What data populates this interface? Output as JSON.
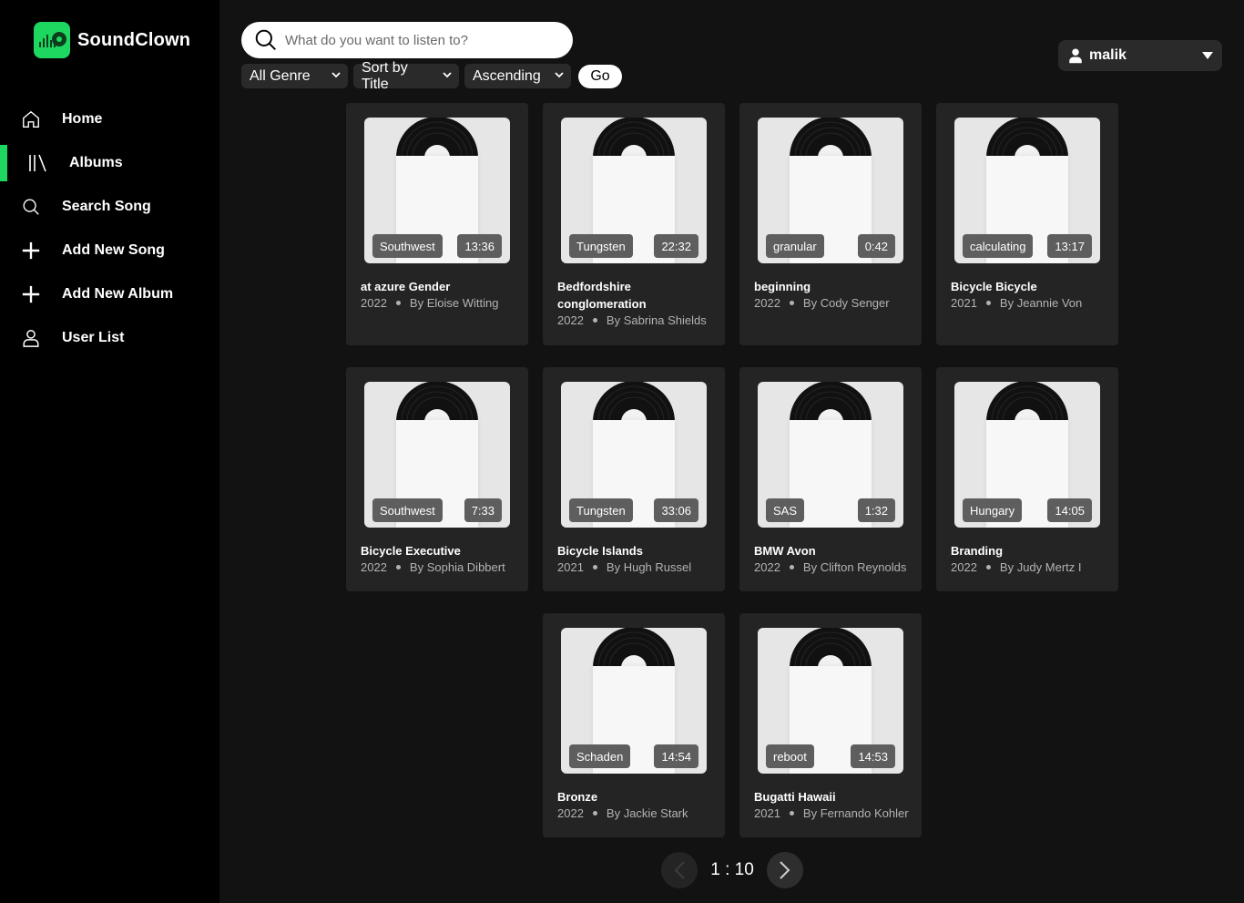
{
  "app": {
    "name": "SoundClown",
    "accent": "#1ed760"
  },
  "sidebar": {
    "items": [
      {
        "label": "Home",
        "icon": "home-icon",
        "active": false
      },
      {
        "label": "Albums",
        "icon": "library-icon",
        "active": true
      },
      {
        "label": "Search Song",
        "icon": "search-icon",
        "active": false
      },
      {
        "label": "Add New Song",
        "icon": "plus-icon",
        "active": false
      },
      {
        "label": "Add New Album",
        "icon": "plus-icon",
        "active": false
      },
      {
        "label": "User List",
        "icon": "user-icon",
        "active": false
      }
    ]
  },
  "search": {
    "placeholder": "What do you want to listen to?",
    "value": ""
  },
  "filters": {
    "genre": "All Genre",
    "sort": "Sort by Title",
    "order": "Ascending",
    "go_label": "Go"
  },
  "user": {
    "name": "malik"
  },
  "albums": [
    {
      "title": "at azure Gender",
      "year": "2022",
      "artist": "By Eloise Witting",
      "tag": "Southwest",
      "duration": "13:36"
    },
    {
      "title": "Bedfordshire conglomeration",
      "year": "2022",
      "artist": "By Sabrina Shields",
      "tag": "Tungsten",
      "duration": "22:32"
    },
    {
      "title": "beginning",
      "year": "2022",
      "artist": "By Cody Senger",
      "tag": "granular",
      "duration": "0:42"
    },
    {
      "title": "Bicycle Bicycle",
      "year": "2021",
      "artist": "By Jeannie Von",
      "tag": "calculating",
      "duration": "13:17"
    },
    {
      "title": "Bicycle Executive",
      "year": "2022",
      "artist": "By Sophia Dibbert",
      "tag": "Southwest",
      "duration": "7:33"
    },
    {
      "title": "Bicycle Islands",
      "year": "2021",
      "artist": "By Hugh Russel",
      "tag": "Tungsten",
      "duration": "33:06"
    },
    {
      "title": "BMW Avon",
      "year": "2022",
      "artist": "By Clifton Reynolds",
      "tag": "SAS",
      "duration": "1:32"
    },
    {
      "title": "Branding",
      "year": "2022",
      "artist": "By Judy Mertz I",
      "tag": "Hungary",
      "duration": "14:05"
    },
    {
      "title": "Bronze",
      "year": "2022",
      "artist": "By Jackie Stark",
      "tag": "Schaden",
      "duration": "14:54"
    },
    {
      "title": "Bugatti Hawaii",
      "year": "2021",
      "artist": "By Fernando Kohler",
      "tag": "reboot",
      "duration": "14:53"
    }
  ],
  "pagination": {
    "label": "1 : 10"
  }
}
